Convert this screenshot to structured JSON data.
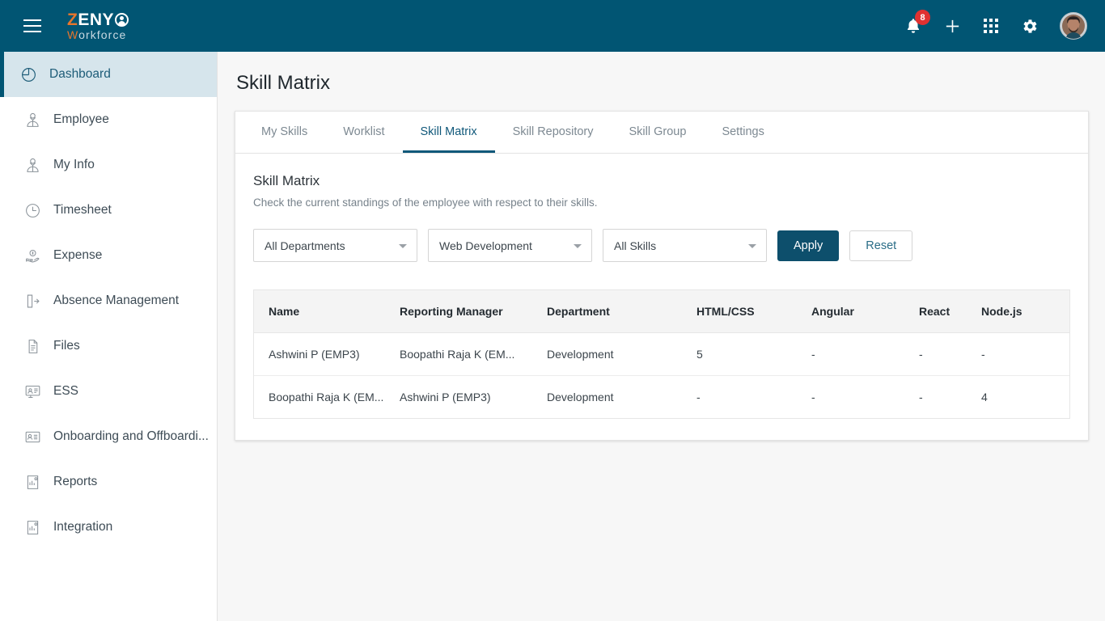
{
  "topbar": {
    "menu_icon": "hamburger-icon",
    "logo": {
      "part1": "Z",
      "part2": "ENY",
      "part3": "W",
      "part4": "orkforce"
    },
    "notifications": {
      "icon": "bell-icon",
      "count": "8"
    },
    "add": {
      "icon": "plus-icon"
    },
    "apps": {
      "icon": "grid-apps-icon"
    },
    "settings": {
      "icon": "gear-icon"
    },
    "profile": {
      "icon": "avatar"
    },
    "bg_color": "#015573",
    "badge_color": "#e03131"
  },
  "sidebar": {
    "items": [
      {
        "label": "Dashboard",
        "icon": "pie-chart-icon",
        "active": true
      },
      {
        "label": "Employee",
        "icon": "employee-icon",
        "active": false
      },
      {
        "label": "My Info",
        "icon": "user-info-icon",
        "active": false
      },
      {
        "label": "Timesheet",
        "icon": "clock-icon",
        "active": false
      },
      {
        "label": "Expense",
        "icon": "money-hand-icon",
        "active": false
      },
      {
        "label": "Absence Management",
        "icon": "door-exit-icon",
        "active": false
      },
      {
        "label": "Files",
        "icon": "file-icon",
        "active": false
      },
      {
        "label": "ESS",
        "icon": "monitor-user-icon",
        "active": false
      },
      {
        "label": "Onboarding and Offboardi...",
        "icon": "id-card-icon",
        "active": false
      },
      {
        "label": "Reports",
        "icon": "report-icon",
        "active": false
      },
      {
        "label": "Integration",
        "icon": "integration-icon",
        "active": false
      }
    ],
    "active_bg": "#d6e5ec",
    "active_accent": "#015573"
  },
  "page": {
    "title": "Skill Matrix"
  },
  "tabs": [
    {
      "label": "My Skills",
      "active": false
    },
    {
      "label": "Worklist",
      "active": false
    },
    {
      "label": "Skill Matrix",
      "active": true
    },
    {
      "label": "Skill Repository",
      "active": false
    },
    {
      "label": "Skill Group",
      "active": false
    },
    {
      "label": "Settings",
      "active": false
    }
  ],
  "section": {
    "title": "Skill Matrix",
    "subtitle": "Check the current standings of the employee with respect to their skills."
  },
  "filters": {
    "department": {
      "value": "All Departments",
      "placeholder": "All Departments"
    },
    "skill_group": {
      "value": "Web Development",
      "placeholder": "Web Development"
    },
    "skill": {
      "value": "All Skills",
      "placeholder": "All Skills"
    },
    "apply_label": "Apply",
    "reset_label": "Reset",
    "apply_color": "#0d4f6c",
    "reset_text_color": "#2a6d87"
  },
  "table": {
    "headers": [
      "Name",
      "Reporting Manager",
      "Department",
      "HTML/CSS",
      "Angular",
      "React",
      "Node.js"
    ],
    "rows": [
      {
        "name": "Ashwini P (EMP3)",
        "manager": "Boopathi Raja K (EM...",
        "department": "Development",
        "html_css": "5",
        "angular": "-",
        "react": "-",
        "nodejs": "-"
      },
      {
        "name": "Boopathi Raja K (EM...",
        "manager": "Ashwini P (EMP3)",
        "department": "Development",
        "html_css": "-",
        "angular": "-",
        "react": "-",
        "nodejs": "4"
      }
    ]
  }
}
